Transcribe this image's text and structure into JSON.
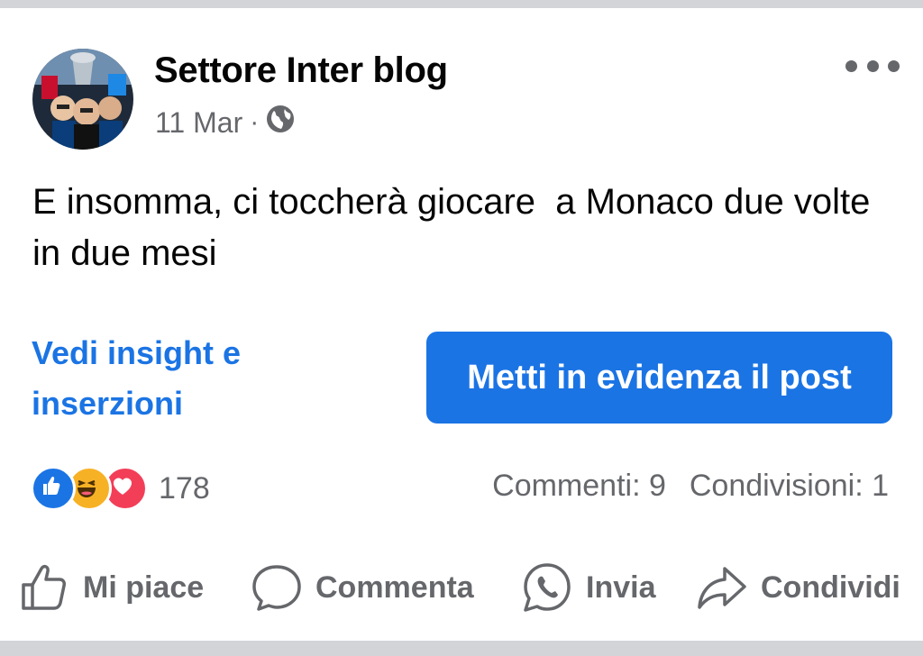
{
  "post": {
    "author": "Settore Inter blog",
    "date": "11 Mar",
    "separator": "·",
    "privacy_icon": "globe-icon",
    "text": "E insomma, ci toccherà giocare  a Monaco due volte in due mesi"
  },
  "promo": {
    "insights_link": "Vedi insight e inserzioni",
    "boost_button": "Metti in evidenza il post"
  },
  "stats": {
    "reaction_icons": [
      "like-icon",
      "haha-icon",
      "love-icon"
    ],
    "reaction_count": "178",
    "comments": "Commenti: 9",
    "shares": "Condivisioni: 1"
  },
  "actions": {
    "like": "Mi piace",
    "comment": "Commenta",
    "send": "Invia",
    "share": "Condividi"
  },
  "colors": {
    "accent": "#1b74e4",
    "secondary_text": "#65676b",
    "separator": "#d2d4d8"
  }
}
